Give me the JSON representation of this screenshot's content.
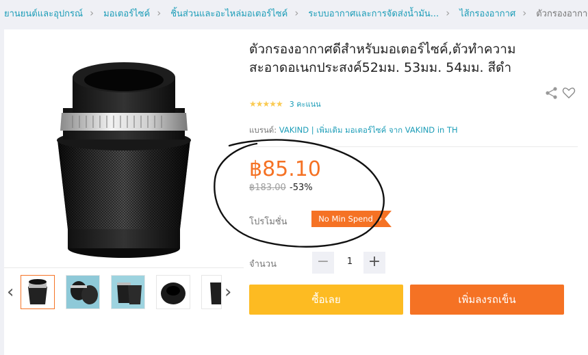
{
  "breadcrumb": [
    {
      "label": "ยานยนต์และอุปกรณ์"
    },
    {
      "label": "มอเตอร์ไซค์"
    },
    {
      "label": "ชิ้นส่วนและอะไหล่มอเตอร์ไซค์"
    },
    {
      "label": "ระบบอากาศและการจัดส่งน้ำมัน..."
    },
    {
      "label": "ไส้กรองอากาศ"
    },
    {
      "label": "ตัวกรองอากาศดี"
    }
  ],
  "product": {
    "title_line1": "ตัวกรองอากาศดีสำหรับมอเตอร์ไซค์,ตัวทำความ",
    "title_line2": "สะอาดอเนกประสงค์52มม. 53มม. 54มม. สีดำ",
    "stars": "★★★★★",
    "rating_count": "3 คะแนน",
    "brand_label": "แบรนด์:",
    "brand_name": "VAKIND",
    "brand_more": "| เพิ่มเติม มอเตอร์ไซค์ จาก VAKIND in TH",
    "price": "฿85.10",
    "old_price": "฿183.00",
    "discount": "-53%",
    "promo_label": "โปรโมชั่น",
    "promo_tag": "No Min Spend",
    "qty_label": "จำนวน",
    "qty_minus": "−",
    "qty_value": "1",
    "qty_plus": "+",
    "buy_now": "ซื้อเลย",
    "add_to_cart": "เพิ่มลงรถเข็น"
  },
  "icons": {
    "share": "share-icon",
    "wishlist": "heart-icon",
    "prev": "chevron-left-icon",
    "next": "chevron-right-icon"
  },
  "colors": {
    "accent": "#f57224",
    "link": "#1a9cb7",
    "buy": "#fdbb22",
    "star": "#faca51"
  }
}
